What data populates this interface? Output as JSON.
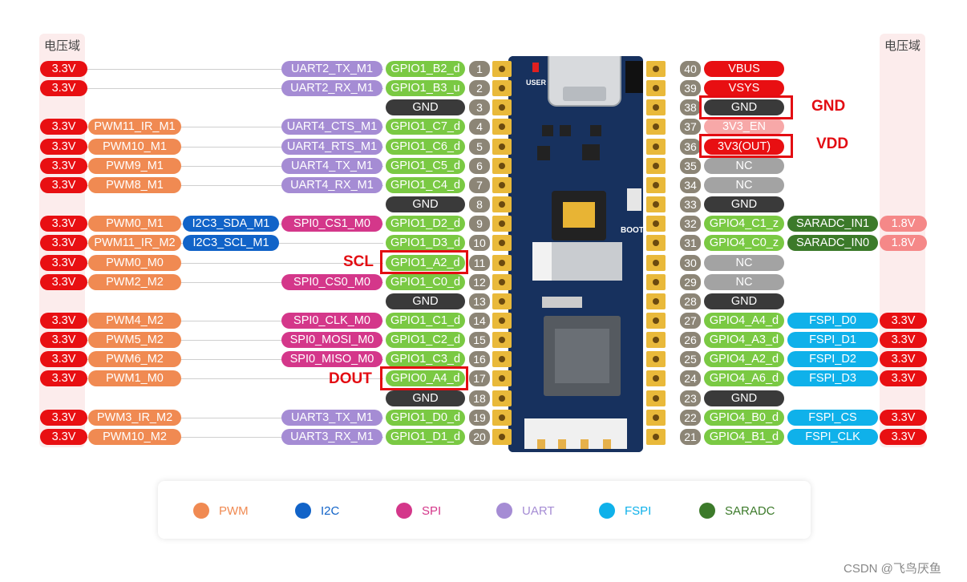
{
  "colors": {
    "power": "#e80f12",
    "pwm": "#f08a52",
    "i2c": "#1163c8",
    "spi": "#d4378a",
    "uart": "#a58cd4",
    "fspi": "#0fb1ea",
    "saradc": "#3c7a2a",
    "gpio": "#7ac943",
    "gnd": "#3a3a3a",
    "nc": "#a3a3a3",
    "v18": "#f58888",
    "en": "#f7a8a8",
    "pinnum": "#8c8576",
    "highlight": "#e30c12"
  },
  "header": {
    "left_title": "电压域",
    "right_title": "电压域"
  },
  "left_pins": [
    {
      "num": "1",
      "gpio": "GPIO1_B2_d",
      "voltage": "3.3V",
      "pwm": "",
      "i2c": "",
      "func": "UART2_TX_M1",
      "func_type": "uart"
    },
    {
      "num": "2",
      "gpio": "GPIO1_B3_u",
      "voltage": "3.3V",
      "pwm": "",
      "i2c": "",
      "func": "UART2_RX_M1",
      "func_type": "uart"
    },
    {
      "num": "3",
      "gpio": "GND",
      "voltage": "",
      "pwm": "",
      "i2c": "",
      "func": "",
      "func_type": ""
    },
    {
      "num": "4",
      "gpio": "GPIO1_C7_d",
      "voltage": "3.3V",
      "pwm": "PWM11_IR_M1",
      "i2c": "",
      "func": "UART4_CTS_M1",
      "func_type": "uart"
    },
    {
      "num": "5",
      "gpio": "GPIO1_C6_d",
      "voltage": "3.3V",
      "pwm": "PWM10_M1",
      "i2c": "",
      "func": "UART4_RTS_M1",
      "func_type": "uart"
    },
    {
      "num": "6",
      "gpio": "GPIO1_C5_d",
      "voltage": "3.3V",
      "pwm": "PWM9_M1",
      "i2c": "",
      "func": "UART4_TX_M1",
      "func_type": "uart"
    },
    {
      "num": "7",
      "gpio": "GPIO1_C4_d",
      "voltage": "3.3V",
      "pwm": "PWM8_M1",
      "i2c": "",
      "func": "UART4_RX_M1",
      "func_type": "uart"
    },
    {
      "num": "8",
      "gpio": "GND",
      "voltage": "",
      "pwm": "",
      "i2c": "",
      "func": "",
      "func_type": ""
    },
    {
      "num": "9",
      "gpio": "GPIO1_D2_d",
      "voltage": "3.3V",
      "pwm": "PWM0_M1",
      "i2c": "I2C3_SDA_M1",
      "func": "SPI0_CS1_M0",
      "func_type": "spi"
    },
    {
      "num": "10",
      "gpio": "GPIO1_D3_d",
      "voltage": "3.3V",
      "pwm": "PWM11_IR_M2",
      "i2c": "I2C3_SCL_M1",
      "func": "",
      "func_type": ""
    },
    {
      "num": "11",
      "gpio": "GPIO1_A2_d",
      "voltage": "3.3V",
      "pwm": "PWM0_M0",
      "i2c": "",
      "func": "",
      "func_type": ""
    },
    {
      "num": "12",
      "gpio": "GPIO1_C0_d",
      "voltage": "3.3V",
      "pwm": "PWM2_M2",
      "i2c": "",
      "func": "SPI0_CS0_M0",
      "func_type": "spi"
    },
    {
      "num": "13",
      "gpio": "GND",
      "voltage": "",
      "pwm": "",
      "i2c": "",
      "func": "",
      "func_type": ""
    },
    {
      "num": "14",
      "gpio": "GPIO1_C1_d",
      "voltage": "3.3V",
      "pwm": "PWM4_M2",
      "i2c": "",
      "func": "SPI0_CLK_M0",
      "func_type": "spi"
    },
    {
      "num": "15",
      "gpio": "GPIO1_C2_d",
      "voltage": "3.3V",
      "pwm": "PWM5_M2",
      "i2c": "",
      "func": "SPI0_MOSI_M0",
      "func_type": "spi"
    },
    {
      "num": "16",
      "gpio": "GPIO1_C3_d",
      "voltage": "3.3V",
      "pwm": "PWM6_M2",
      "i2c": "",
      "func": "SPI0_MISO_M0",
      "func_type": "spi"
    },
    {
      "num": "17",
      "gpio": "GPIO0_A4_d",
      "voltage": "3.3V",
      "pwm": "PWM1_M0",
      "i2c": "",
      "func": "",
      "func_type": ""
    },
    {
      "num": "18",
      "gpio": "GND",
      "voltage": "",
      "pwm": "",
      "i2c": "",
      "func": "",
      "func_type": ""
    },
    {
      "num": "19",
      "gpio": "GPIO1_D0_d",
      "voltage": "3.3V",
      "pwm": "PWM3_IR_M2",
      "i2c": "",
      "func": "UART3_TX_M1",
      "func_type": "uart"
    },
    {
      "num": "20",
      "gpio": "GPIO1_D1_d",
      "voltage": "3.3V",
      "pwm": "PWM10_M2",
      "i2c": "",
      "func": "UART3_RX_M1",
      "func_type": "uart"
    }
  ],
  "right_pins": [
    {
      "num": "40",
      "label": "VBUS",
      "type": "power",
      "func": "",
      "func_type": "",
      "voltage": "",
      "vtype": ""
    },
    {
      "num": "39",
      "label": "VSYS",
      "type": "power",
      "func": "",
      "func_type": "",
      "voltage": "",
      "vtype": ""
    },
    {
      "num": "38",
      "label": "GND",
      "type": "gnd",
      "func": "",
      "func_type": "",
      "voltage": "",
      "vtype": ""
    },
    {
      "num": "37",
      "label": "3V3_EN",
      "type": "en",
      "func": "",
      "func_type": "",
      "voltage": "",
      "vtype": ""
    },
    {
      "num": "36",
      "label": "3V3(OUT)",
      "type": "power",
      "func": "",
      "func_type": "",
      "voltage": "",
      "vtype": ""
    },
    {
      "num": "35",
      "label": "NC",
      "type": "nc",
      "func": "",
      "func_type": "",
      "voltage": "",
      "vtype": ""
    },
    {
      "num": "34",
      "label": "NC",
      "type": "nc",
      "func": "",
      "func_type": "",
      "voltage": "",
      "vtype": ""
    },
    {
      "num": "33",
      "label": "GND",
      "type": "gnd",
      "func": "",
      "func_type": "",
      "voltage": "",
      "vtype": ""
    },
    {
      "num": "32",
      "label": "GPIO4_C1_z",
      "type": "gpio",
      "func": "SARADC_IN1",
      "func_type": "saradc",
      "voltage": "1.8V",
      "vtype": "v18"
    },
    {
      "num": "31",
      "label": "GPIO4_C0_z",
      "type": "gpio",
      "func": "SARADC_IN0",
      "func_type": "saradc",
      "voltage": "1.8V",
      "vtype": "v18"
    },
    {
      "num": "30",
      "label": "NC",
      "type": "nc",
      "func": "",
      "func_type": "",
      "voltage": "",
      "vtype": ""
    },
    {
      "num": "29",
      "label": "NC",
      "type": "nc",
      "func": "",
      "func_type": "",
      "voltage": "",
      "vtype": ""
    },
    {
      "num": "28",
      "label": "GND",
      "type": "gnd",
      "func": "",
      "func_type": "",
      "voltage": "",
      "vtype": ""
    },
    {
      "num": "27",
      "label": "GPIO4_A4_d",
      "type": "gpio",
      "func": "FSPI_D0",
      "func_type": "fspi",
      "voltage": "3.3V",
      "vtype": "power"
    },
    {
      "num": "26",
      "label": "GPIO4_A3_d",
      "type": "gpio",
      "func": "FSPI_D1",
      "func_type": "fspi",
      "voltage": "3.3V",
      "vtype": "power"
    },
    {
      "num": "25",
      "label": "GPIO4_A2_d",
      "type": "gpio",
      "func": "FSPI_D2",
      "func_type": "fspi",
      "voltage": "3.3V",
      "vtype": "power"
    },
    {
      "num": "24",
      "label": "GPIO4_A6_d",
      "type": "gpio",
      "func": "FSPI_D3",
      "func_type": "fspi",
      "voltage": "3.3V",
      "vtype": "power"
    },
    {
      "num": "23",
      "label": "GND",
      "type": "gnd",
      "func": "",
      "func_type": "",
      "voltage": "",
      "vtype": ""
    },
    {
      "num": "22",
      "label": "GPIO4_B0_d",
      "type": "gpio",
      "func": "FSPI_CS",
      "func_type": "fspi",
      "voltage": "3.3V",
      "vtype": "power"
    },
    {
      "num": "21",
      "label": "GPIO4_B1_d",
      "type": "gpio",
      "func": "FSPI_CLK",
      "func_type": "fspi",
      "voltage": "3.3V",
      "vtype": "power"
    }
  ],
  "annotations": {
    "gnd": "GND",
    "vdd": "VDD",
    "scl": "SCL",
    "dout": "DOUT"
  },
  "board": {
    "user_label": "USER",
    "boot_label": "BOOT"
  },
  "legend": [
    {
      "label": "PWM",
      "color": "#f08a52"
    },
    {
      "label": "I2C",
      "color": "#1163c8"
    },
    {
      "label": "SPI",
      "color": "#d4378a"
    },
    {
      "label": "UART",
      "color": "#a58cd4"
    },
    {
      "label": "FSPI",
      "color": "#0fb1ea"
    },
    {
      "label": "SARADC",
      "color": "#3c7a2a"
    }
  ],
  "watermark": "CSDN @飞鸟厌鱼"
}
